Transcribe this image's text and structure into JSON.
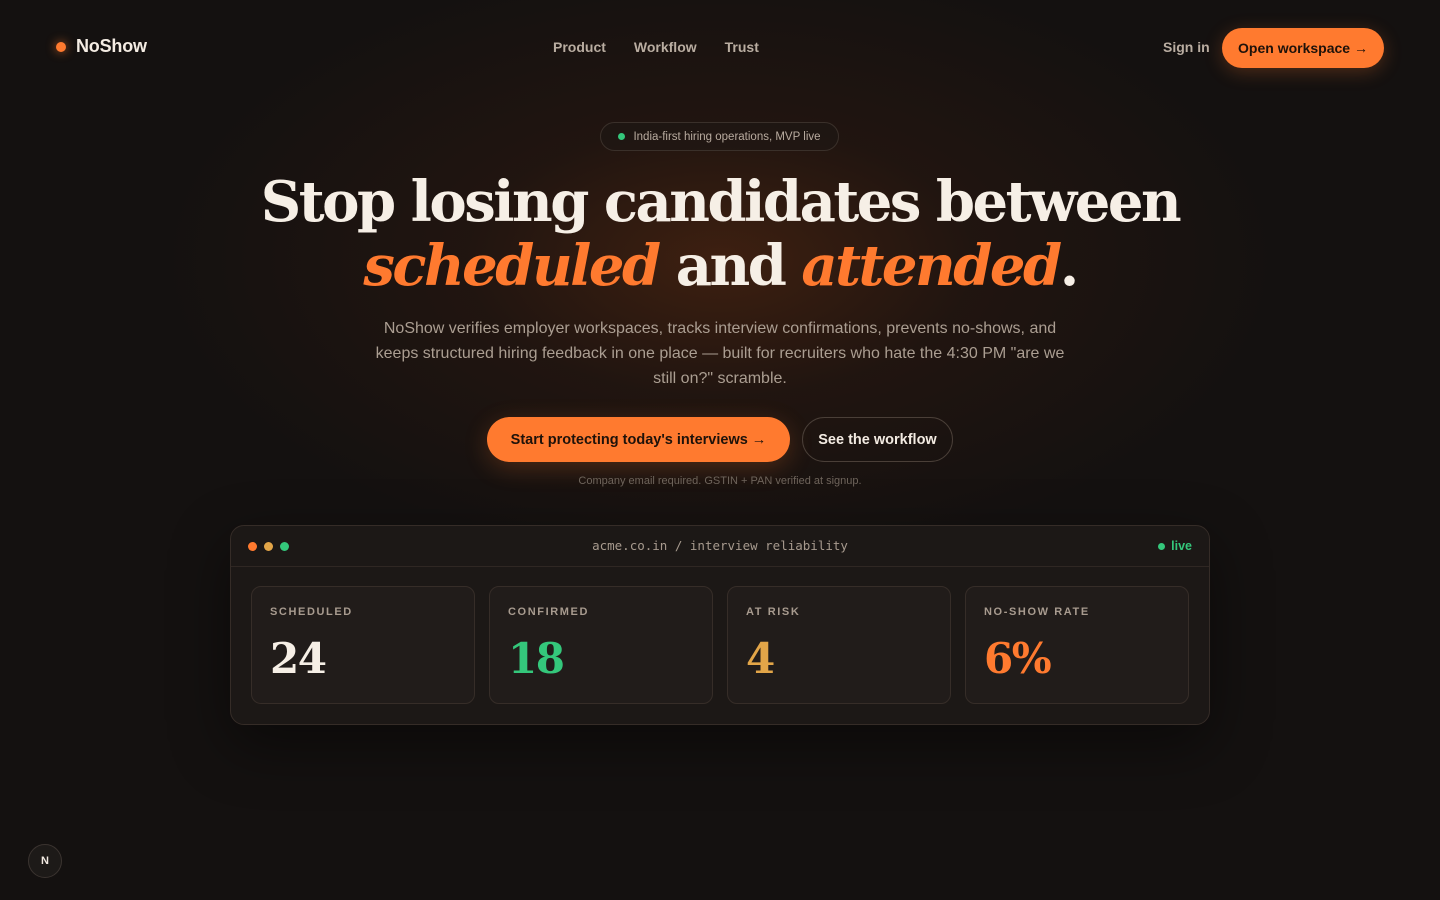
{
  "nav": {
    "brand": "NoShow",
    "links": [
      "Product",
      "Workflow",
      "Trust"
    ],
    "sign_in": "Sign in",
    "cta": "Open workspace →"
  },
  "hero": {
    "pill": "India-first hiring operations, MVP live",
    "headline_line1": "Stop losing candidates between",
    "headline_accent1": "scheduled",
    "headline_and": " and ",
    "headline_accent2": "attended",
    "headline_end": ".",
    "subcopy": "NoShow verifies employer workspaces, tracks interview confirmations, prevents no-shows, and keeps structured hiring feedback in one place — built for recruiters who hate the 4:30 PM \"are we still on?\" scramble.",
    "cta_primary": "Start protecting today's interviews →",
    "cta_secondary": "See the workflow",
    "fineprint": "Company email required. GSTIN + PAN verified at signup."
  },
  "panel": {
    "url": "acme.co.in / interview reliability",
    "status": "live",
    "stats": [
      {
        "label": "SCHEDULED",
        "value": "24",
        "color": "#f6efe6"
      },
      {
        "label": "CONFIRMED",
        "value": "18",
        "color": "#34c77b"
      },
      {
        "label": "AT RISK",
        "value": "4",
        "color": "#e2a548"
      },
      {
        "label": "NO-SHOW RATE",
        "value": "6%",
        "color": "#ff7a2f"
      }
    ]
  },
  "corner_badge": "N",
  "colors": {
    "accent": "#ff7a2f",
    "success": "#34c77b",
    "warning": "#e2a548",
    "background": "#141110"
  }
}
